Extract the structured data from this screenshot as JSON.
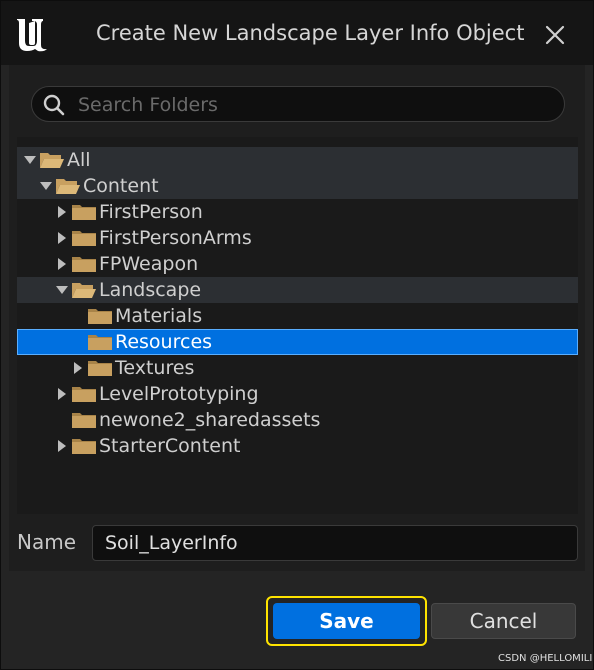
{
  "window": {
    "title": "Create New Landscape Layer Info Object",
    "close_icon": "close-icon",
    "logo_icon": "unreal-engine-logo"
  },
  "search": {
    "placeholder": "Search Folders",
    "value": ""
  },
  "tree": {
    "items": [
      {
        "label": "All",
        "expanded": true,
        "has_children": true,
        "selected": false,
        "highlighted": true
      },
      {
        "label": "Content",
        "expanded": true,
        "has_children": true,
        "selected": false,
        "highlighted": true
      },
      {
        "label": "FirstPerson",
        "expanded": false,
        "has_children": true,
        "selected": false,
        "highlighted": false
      },
      {
        "label": "FirstPersonArms",
        "expanded": false,
        "has_children": true,
        "selected": false,
        "highlighted": false
      },
      {
        "label": "FPWeapon",
        "expanded": false,
        "has_children": true,
        "selected": false,
        "highlighted": false
      },
      {
        "label": "Landscape",
        "expanded": true,
        "has_children": true,
        "selected": false,
        "highlighted": true
      },
      {
        "label": "Materials",
        "expanded": false,
        "has_children": false,
        "selected": false,
        "highlighted": false
      },
      {
        "label": "Resources",
        "expanded": false,
        "has_children": false,
        "selected": true,
        "highlighted": false
      },
      {
        "label": "Textures",
        "expanded": false,
        "has_children": true,
        "selected": false,
        "highlighted": false
      },
      {
        "label": "LevelPrototyping",
        "expanded": false,
        "has_children": true,
        "selected": false,
        "highlighted": false
      },
      {
        "label": "newone2_sharedassets",
        "expanded": false,
        "has_children": false,
        "selected": false,
        "highlighted": false
      },
      {
        "label": "StarterContent",
        "expanded": false,
        "has_children": true,
        "selected": false,
        "highlighted": false
      }
    ]
  },
  "name_field": {
    "label": "Name",
    "value": "Soil_LayerInfo"
  },
  "buttons": {
    "save": "Save",
    "cancel": "Cancel"
  },
  "colors": {
    "accent": "#0070e0",
    "focus_ring": "#ffe400",
    "folder": "#c8a060"
  },
  "watermark": "CSDN @HELLOMILI"
}
